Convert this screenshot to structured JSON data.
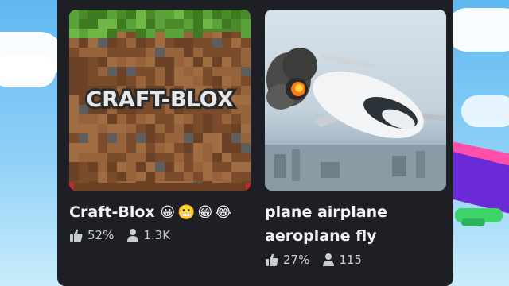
{
  "games": [
    {
      "title": "Craft-Blox",
      "title_emojis": "😀😬😁😂",
      "thumbnail_text": "CRAFT-BLOX",
      "rating": "52%",
      "players": "1.3K"
    },
    {
      "title": "plane airplane aeroplane fly",
      "rating": "27%",
      "players": "115"
    }
  ],
  "icons": {
    "rating": "thumbs-up-icon",
    "players": "person-icon"
  },
  "colors": {
    "panel_bg": "#1d1f24",
    "title_text": "#f2f3f5",
    "stat_text": "#c9ccd1"
  }
}
